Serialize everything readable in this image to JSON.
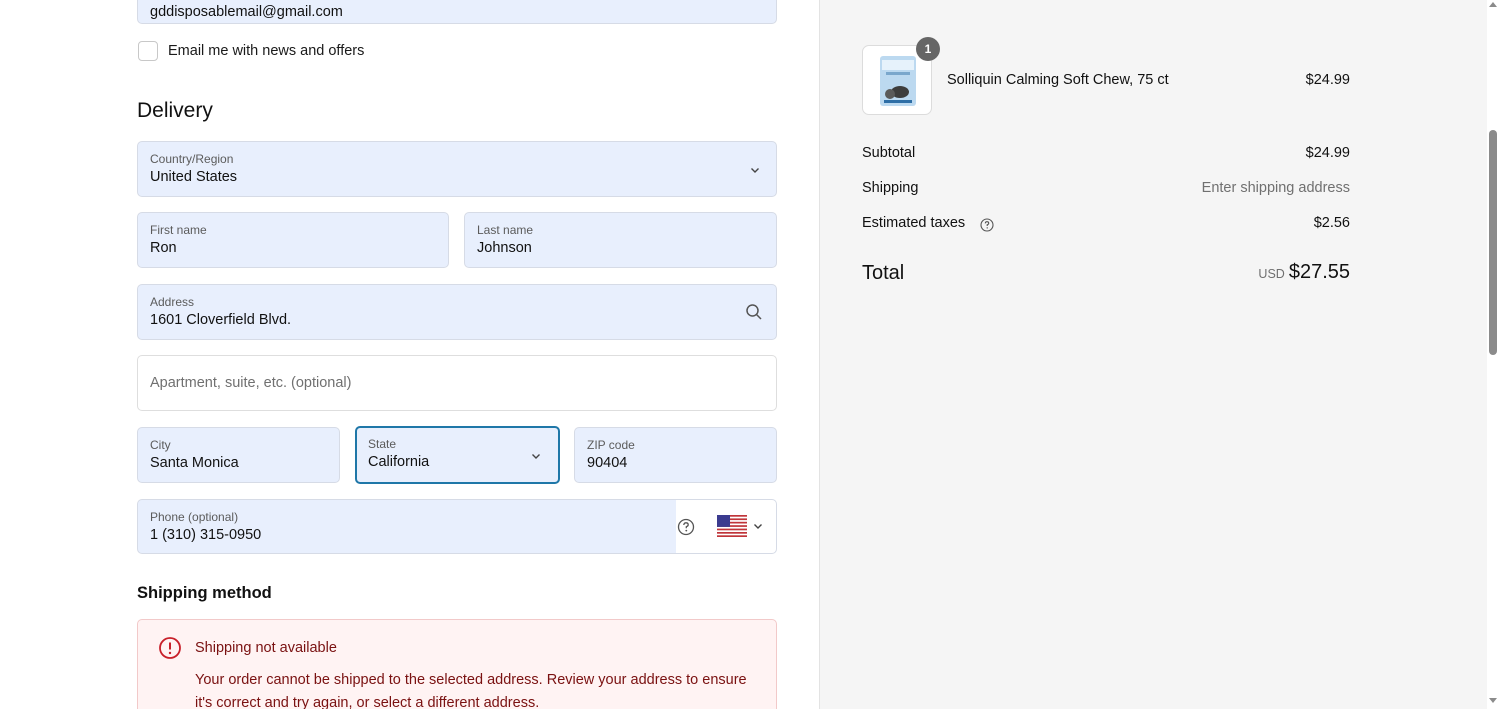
{
  "contact": {
    "email_value": "gddisposablemail@gmail.com",
    "newsletter_label": "Email me with news and offers"
  },
  "delivery": {
    "heading": "Delivery",
    "country": {
      "label": "Country/Region",
      "value": "United States"
    },
    "first_name": {
      "label": "First name",
      "value": "Ron"
    },
    "last_name": {
      "label": "Last name",
      "value": "Johnson"
    },
    "address": {
      "label": "Address",
      "value": "1601 Cloverfield Blvd."
    },
    "apartment": {
      "placeholder": "Apartment, suite, etc. (optional)"
    },
    "city": {
      "label": "City",
      "value": "Santa Monica"
    },
    "state": {
      "label": "State",
      "value": "California"
    },
    "zip": {
      "label": "ZIP code",
      "value": "90404"
    },
    "phone": {
      "label": "Phone (optional)",
      "value": "1 (310) 315-0950"
    }
  },
  "shipping_method": {
    "heading": "Shipping method",
    "alert_title": "Shipping not available",
    "alert_body": "Your order cannot be shipped to the selected address. Review your address to ensure it's correct and try again, or select a different address."
  },
  "summary": {
    "item": {
      "quantity": "1",
      "name": "Solliquin Calming Soft Chew, 75 ct",
      "price": "$24.99"
    },
    "subtotal": {
      "label": "Subtotal",
      "value": "$24.99"
    },
    "shipping": {
      "label": "Shipping",
      "value": "Enter shipping address"
    },
    "taxes": {
      "label": "Estimated taxes",
      "value": "$2.56"
    },
    "total": {
      "label": "Total",
      "currency": "USD",
      "value": "$27.55"
    }
  },
  "colors": {
    "field_bg": "#e8effd",
    "focus_border": "#1f77a8",
    "alert_bg": "#fff3f3",
    "alert_text": "#7a1111"
  }
}
